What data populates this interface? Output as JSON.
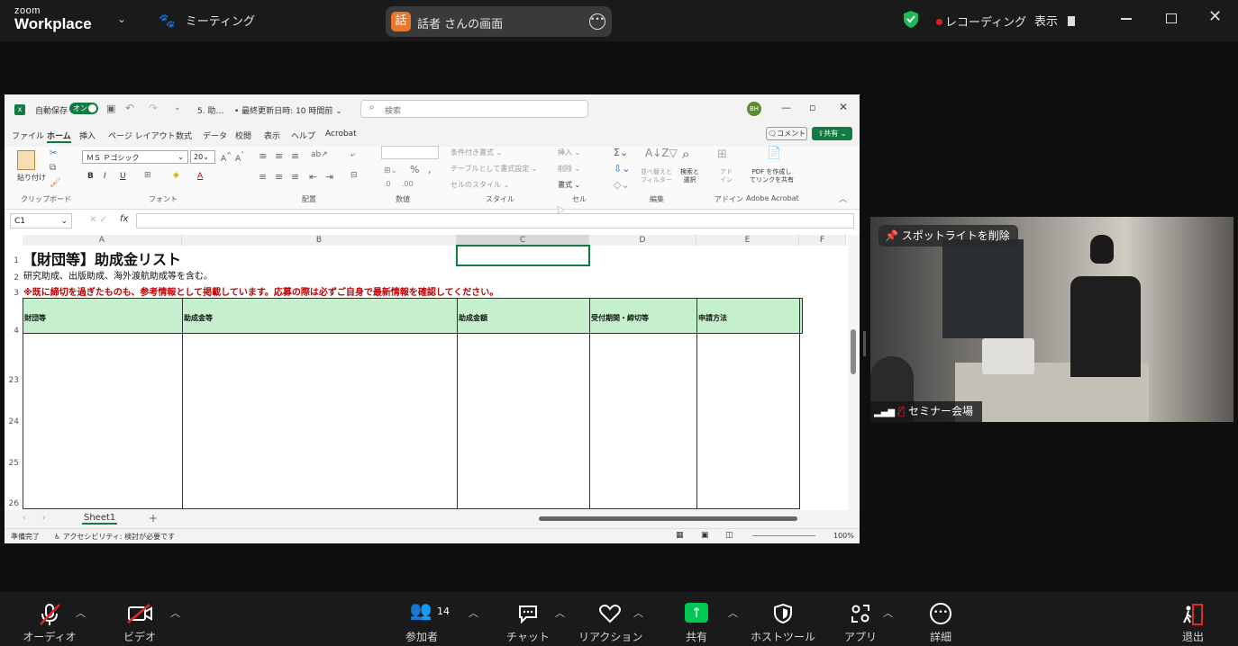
{
  "topbar": {
    "logo_line1": "zoom",
    "logo_line2": "Workplace",
    "meeting_label": "ミーティング",
    "share_badge": "話",
    "share_title": "話者 さんの画面",
    "recording_label": "レコーディング",
    "view_label": "表示"
  },
  "excel": {
    "autosave_label": "自動保存",
    "autosave_toggle": "オン",
    "file_name": "5. 助…",
    "last_saved": "• 最終更新日時: 10 時間前 ⌄",
    "search_placeholder": "検索",
    "avatar": "BH",
    "menu": [
      "ファイル",
      "ホーム",
      "挿入",
      "ページ レイアウト",
      "数式",
      "データ",
      "校閲",
      "表示",
      "ヘルプ",
      "Acrobat"
    ],
    "comment_button": "コメント",
    "share_button": "共有",
    "ribbon": {
      "paste": "貼り付け",
      "font_name": "ＭＳ Ｐゴシック",
      "font_size": "20",
      "groups": [
        "クリップボード",
        "フォント",
        "配置",
        "数値",
        "スタイル",
        "セル",
        "編集",
        "アドイン",
        "Adobe Acrobat"
      ],
      "style_items": [
        "条件付き書式 ⌄",
        "テーブルとして書式設定 ⌄",
        "セルのスタイル ⌄"
      ],
      "cell_items": [
        "挿入 ⌄",
        "削除 ⌄",
        "書式 ⌄"
      ],
      "sort_filter": "並べ替えと\nフィルター",
      "find_select": "検索と\n選択",
      "addins": "アド\nイン",
      "pdf": "PDF を作成し\nてリンクを共有"
    },
    "name_box": "C1",
    "fx": "fx",
    "columns": [
      "A",
      "B",
      "C",
      "D",
      "E",
      "F"
    ],
    "rows": [
      "1",
      "2",
      "3",
      "4",
      "23",
      "24",
      "25",
      "26"
    ],
    "title": "【財団等】助成金リスト",
    "subtitle": "研究助成、出版助成、海外渡航助成等を含む。",
    "warning": "※既に締切を過ぎたものも、参考情報として掲載しています。応募の際は必ずご自身で最新情報を確認してください。",
    "headers": [
      "財団等",
      "助成金等",
      "助成金額",
      "受付期間・締切等",
      "申請方法"
    ],
    "sheet_tab": "Sheet1",
    "status_ready": "準備完了",
    "status_accessibility": "アクセシビリティ: 検討が必要です",
    "zoom": "100%"
  },
  "video": {
    "remove_spotlight": "スポットライトを削除",
    "participant_name": "セミナー会場"
  },
  "bottombar": {
    "audio": "オーディオ",
    "video": "ビデオ",
    "participants": "参加者",
    "participants_count": "14",
    "chat": "チャット",
    "reactions": "リアクション",
    "share": "共有",
    "host_tools": "ホストツール",
    "apps": "アプリ",
    "more": "詳細",
    "leave": "退出"
  },
  "colors": {
    "excel_green": "#107c41",
    "header_fill": "#c6efce",
    "warning_red": "#c00000",
    "share_badge": "#e8772e",
    "share_green": "#00c853"
  }
}
